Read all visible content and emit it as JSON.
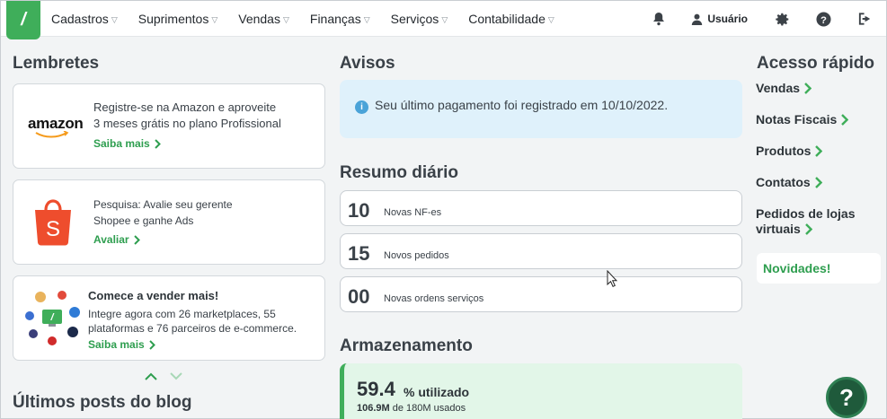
{
  "nav": {
    "items": [
      "Cadastros",
      "Suprimentos",
      "Vendas",
      "Finanças",
      "Serviços",
      "Contabilidade"
    ],
    "user_label": "Usuário"
  },
  "reminders": {
    "title": "Lembretes",
    "cards": [
      {
        "logo_text": "amazon",
        "line1": "Registre-se na Amazon e aproveite",
        "line2": "3 meses grátis no plano Profissional",
        "link": "Saiba mais"
      },
      {
        "line1": "Pesquisa: Avalie seu gerente",
        "line2": "Shopee e ganhe Ads",
        "link": "Avaliar"
      },
      {
        "heading": "Comece a vender mais!",
        "line1": "Integre agora com 26 marketplaces, 55",
        "line2": "plataformas e 76 parceiros de e-commerce.",
        "link": "Saiba mais"
      }
    ]
  },
  "blog": {
    "title": "Últimos posts do blog"
  },
  "notices": {
    "title": "Avisos",
    "message": "Seu último pagamento foi registrado em 10/10/2022."
  },
  "daily": {
    "title": "Resumo diário",
    "stats": [
      {
        "value": "10",
        "label": "Novas NF-es"
      },
      {
        "value": "15",
        "label": "Novos pedidos"
      },
      {
        "value": "00",
        "label": "Novas ordens serviços"
      }
    ]
  },
  "storage": {
    "title": "Armazenamento",
    "percent": "59.4",
    "percent_label": "% utilizado",
    "used": "106.9M",
    "used_suffix": "de 180M usados"
  },
  "quick_access": {
    "title": "Acesso rápido",
    "links": [
      "Vendas",
      "Notas Fiscais",
      "Produtos",
      "Contatos"
    ],
    "virtual_line1": "Pedidos de lojas",
    "virtual_line2": "virtuais",
    "news": "Novidades!"
  },
  "colors": {
    "brand_green": "#3fae5a",
    "link_green": "#2e9e4f",
    "notice_bg": "#dff1fb"
  }
}
